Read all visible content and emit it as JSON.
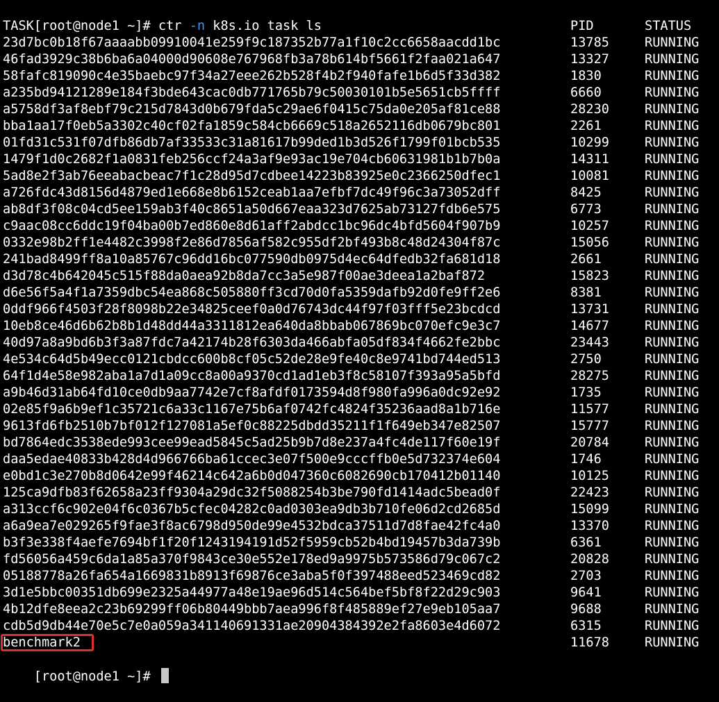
{
  "prompt": "[root@node1 ~]# ",
  "command": {
    "cmd": "ctr ",
    "flag": "-n",
    "rest": " k8s.io task ls"
  },
  "headers": {
    "task": "TASK",
    "pid": "PID",
    "status": "STATUS"
  },
  "rows": [
    {
      "task": "23d7bc0b18f67aaaabb09910041e259f9c187352b77a1f10c2cc6658aacdd1bc",
      "pid": "13785",
      "status": "RUNNING"
    },
    {
      "task": "46fad3929c38b6ba6a04000d90608e767968fb3a78b614bf5661f2faa021a647",
      "pid": "13327",
      "status": "RUNNING"
    },
    {
      "task": "58fafc819090c4e35baebc97f34a27eee262b528f4b2f940fafe1b6d5f33d382",
      "pid": "1830",
      "status": "RUNNING"
    },
    {
      "task": "a235bd94121289e184f3bde643cac0db771765b79c50030101b5e5651cb5ffff",
      "pid": "6660",
      "status": "RUNNING"
    },
    {
      "task": "a5758df3af8ebf79c215d7843d0b679fda5c29ae6f0415c75da0e205af81ce88",
      "pid": "28230",
      "status": "RUNNING"
    },
    {
      "task": "bba1aa17f0eb5a3302c40cf02fa1859c584cb6669c518a2652116db0679bc801",
      "pid": "2261",
      "status": "RUNNING"
    },
    {
      "task": "01fd31c531f07dfb86db7af33533c31a81617b99ded1b3d526f1799f01bcb535",
      "pid": "10299",
      "status": "RUNNING"
    },
    {
      "task": "1479f1d0c2682f1a0831feb256ccf24a3af9e93ac19e704cb6063198 1b1b7b0a",
      "pid": "14311",
      "status": "RUNNING"
    },
    {
      "task": "5ad8e2f3ab76eeabacbeac7f1c28d95d7cdbee14223b83925e0c2366250dfec1",
      "pid": "10081",
      "status": "RUNNING"
    },
    {
      "task": "a726fdc43d8156d4879ed1e668e8b6152ceab1aa7efbf7dc49f96c3a73052dff",
      "pid": "8425",
      "status": "RUNNING"
    },
    {
      "task": "ab8df3f08c04cd5ee159ab3f40c8651a50d667eaa323d7625ab73127fdb6e575",
      "pid": "6773",
      "status": "RUNNING"
    },
    {
      "task": "c9aac08cc6ddc19f04ba00b7ed860e8d61aff2abdcc1bc96dc4bfd5604f907b9",
      "pid": "10257",
      "status": "RUNNING"
    },
    {
      "task": "0332e98b2ff1e4482c3998f2e86d7856af582c955df2bf493b8c48d24304f87c",
      "pid": "15056",
      "status": "RUNNING"
    },
    {
      "task": "241bad8499ff8a10a85767c96dd16bc077590db0975d4ec64dfedb32fa681d18",
      "pid": "2661",
      "status": "RUNNING"
    },
    {
      "task": "d3d78c4b642045c515f88da0aea92b8da7cc3a5e987f00ae3deea1a2baf872",
      "pid": "15823",
      "status": "RUNNING"
    },
    {
      "task": "d6e56f5a4f1a7359dbc54ea868c505880ff3cd70d0fa5359dafb92d0fe9ff2e6",
      "pid": "8381",
      "status": "RUNNING"
    },
    {
      "task": "0ddf966f4503f28f8098b22e34825ceef0a0d76743dc44f97f03fff5e23bcdcd",
      "pid": "13731",
      "status": "RUNNING"
    },
    {
      "task": "10eb8ce46d6b62b8b1d48dd44a3311812ea640da8bbab067869bc070efc9e3c7",
      "pid": "14677",
      "status": "RUNNING"
    },
    {
      "task": "40d97a8a9bd6b3f3a87fdc7a42174b28f6303da466abfa05df834f4662fe2bbc",
      "pid": "23443",
      "status": "RUNNING"
    },
    {
      "task": "4e534c64d5b49ecc0121cbdcc600b8cf05c52de28e9fe40c8e9741bd744ed513",
      "pid": "2750",
      "status": "RUNNING"
    },
    {
      "task": "64f1d4e58e982aba1a7d1a09cc8a00a9370cd1ad1eb3f8c58107f393a95a5bfd",
      "pid": "28275",
      "status": "RUNNING"
    },
    {
      "task": "a9b46d31ab64fd10ce0db9aa7742e7cf8afdf0173594d8f980fa996a0dc92e92",
      "pid": "1735",
      "status": "RUNNING"
    },
    {
      "task": "02e85f9a6b9ef1c35721c6a33c1167e75b6af0742fc4824f35236aad8a1b716e",
      "pid": "11577",
      "status": "RUNNING"
    },
    {
      "task": "9613fd6fb2510b7bf012f127081a5ef0c88225dbdd35211f1f649eb347e82507",
      "pid": "15777",
      "status": "RUNNING"
    },
    {
      "task": "bd7864edc3538ede993cee99ead5845c5ad25b9b7d8e237a4fc4de117f60e19f",
      "pid": "20784",
      "status": "RUNNING"
    },
    {
      "task": "daa5edae40833b428d4d966766ba61ccec3e07f500e9cccffb0e5d732374e604",
      "pid": "1746",
      "status": "RUNNING"
    },
    {
      "task": "e0bd1c3e270b8d0642e99f46214c642a6b0d047360c6082690cb170412b01140",
      "pid": "10125",
      "status": "RUNNING"
    },
    {
      "task": "125ca9dfb83f62658a23ff9304a29dc32f5088254b3be790fd1414adc5bead0f",
      "pid": "22423",
      "status": "RUNNING"
    },
    {
      "task": "a313ccf6c902e04f6c0367b5cfec04282c0ad0303ea9db3b710fe06d2cd2685d",
      "pid": "15099",
      "status": "RUNNING"
    },
    {
      "task": "a6a9ea7e029265f9fae3f8ac6798d950de99e4532bdca37511d7d8fae42fc4a0",
      "pid": "13370",
      "status": "RUNNING"
    },
    {
      "task": "b3f3e338f4aefe7694bf1f20f1243194191d52f5959cb52b4bd19457b3da739b",
      "pid": "6361",
      "status": "RUNNING"
    },
    {
      "task": "fd56056a459c6da1a85a370f9843ce30e552e178ed9a9975b573586d79c067c2",
      "pid": "20828",
      "status": "RUNNING"
    },
    {
      "task": "05188778a26fa654a1669831b8913f69876ce3aba5f0f397488eed523469cd82",
      "pid": "2703",
      "status": "RUNNING"
    },
    {
      "task": "3d1e5bbc00351db699e2325a44977a48e19ae96d514c564bef5bf8f22d29c903",
      "pid": "9641",
      "status": "RUNNING"
    },
    {
      "task": "4b12dfe8eea2c23b69299ff06b80449bbb7aea996f8f485889ef27e9eb105aa7",
      "pid": "9688",
      "status": "RUNNING"
    },
    {
      "task": "cdb5d9db44e70e5c7e0a059a341140691331ae20904384392e2fa8603e4d6072",
      "pid": "6315",
      "status": "RUNNING"
    },
    {
      "task": "benchmark2",
      "pid": "11678",
      "status": "RUNNING"
    }
  ],
  "colors": {
    "background": "#000000",
    "text": "#ffffff",
    "flag": "#4f8fe6",
    "highlight": "#e0302a"
  }
}
